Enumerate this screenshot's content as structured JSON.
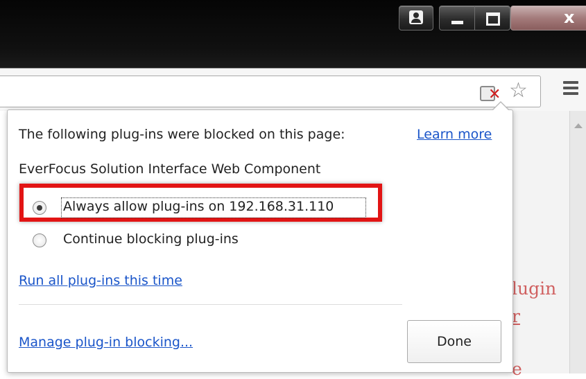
{
  "window": {
    "buttons": {
      "close_glyph": "x"
    }
  },
  "toolbar": {
    "icons": [
      "blocked-plugin-icon",
      "bookmark-star-icon",
      "menu-icon"
    ]
  },
  "page_background": {
    "text_fragments": [
      "lugin",
      "r",
      "e"
    ]
  },
  "bubble": {
    "heading": "The following plug-ins were blocked on this page:",
    "learn_more": "Learn more",
    "plugin_name": "EverFocus Solution Interface Web Component",
    "options": [
      {
        "label": "Always allow plug-ins on 192.168.31.110",
        "checked": true
      },
      {
        "label": "Continue blocking plug-ins",
        "checked": false
      }
    ],
    "run_all": "Run all plug-ins this time",
    "manage": "Manage plug-in blocking...",
    "done": "Done"
  },
  "colors": {
    "link": "#1a55c9",
    "highlight": "#e21414"
  }
}
